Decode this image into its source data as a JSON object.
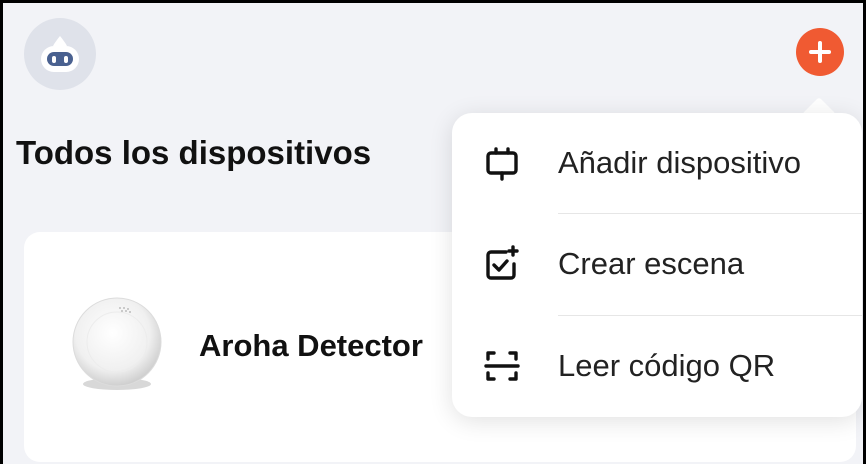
{
  "header": {
    "avatar_icon": "robot-face-icon",
    "add_icon": "plus-icon",
    "accent_color": "#f05a32"
  },
  "main": {
    "section_title": "Todos los dispositivos",
    "device": {
      "name": "Aroha Detector",
      "image": "smoke-detector-device"
    }
  },
  "popup_menu": {
    "items": [
      {
        "label": "Añadir dispositivo",
        "icon": "add-device-icon"
      },
      {
        "label": "Crear escena",
        "icon": "create-scene-icon"
      },
      {
        "label": "Leer código QR",
        "icon": "qr-scan-icon"
      }
    ]
  }
}
